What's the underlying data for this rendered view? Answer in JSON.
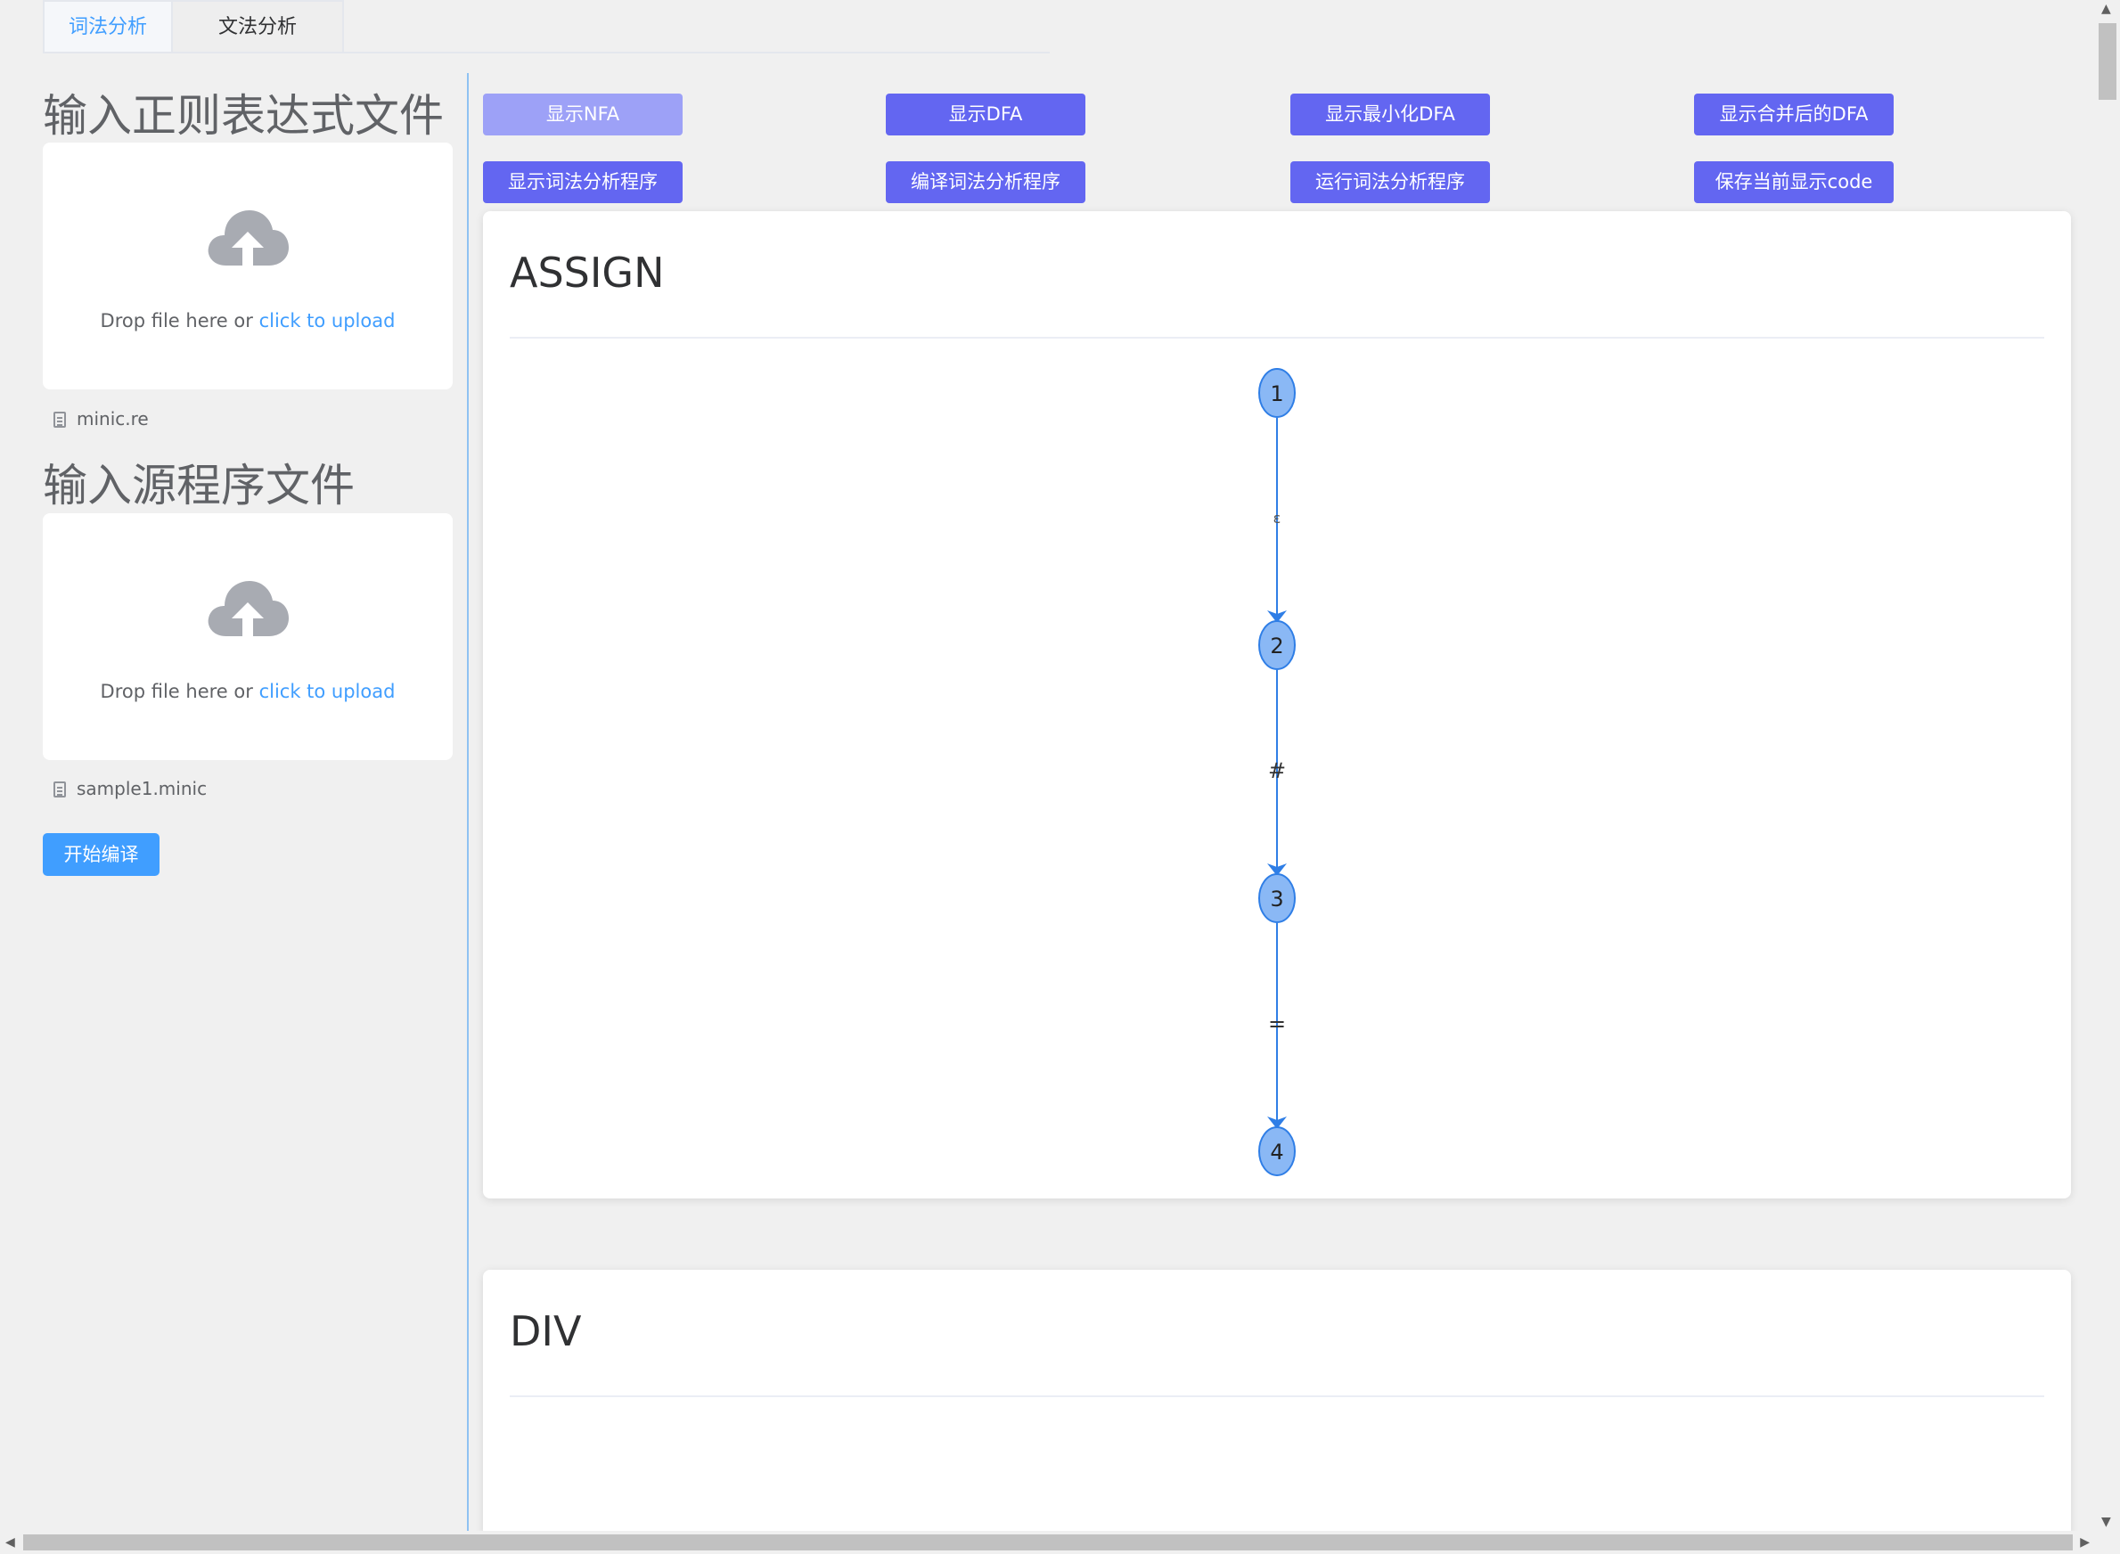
{
  "tabs": [
    {
      "label": "词法分析",
      "active": true
    },
    {
      "label": "文法分析",
      "active": false
    }
  ],
  "sidebar": {
    "regex_section": {
      "title": "输入正则表达式文件",
      "upload_prefix": "Drop file here or ",
      "upload_link": "click to upload",
      "file_name": "minic.re"
    },
    "source_section": {
      "title": "输入源程序文件",
      "upload_prefix": "Drop file here or ",
      "upload_link": "click to upload",
      "file_name": "sample1.minic"
    },
    "compile_label": "开始编译"
  },
  "toolbar": {
    "buttons": [
      {
        "label": "显示NFA",
        "active": true
      },
      {
        "label": "显示DFA"
      },
      {
        "label": "显示最小化DFA"
      },
      {
        "label": "显示合并后的DFA"
      },
      {
        "label": "显示词法分析程序"
      },
      {
        "label": "编译词法分析程序"
      },
      {
        "label": "运行词法分析程序"
      },
      {
        "label": "保存当前显示code"
      }
    ]
  },
  "cards": [
    {
      "title": "ASSIGN",
      "graph": {
        "nodes": [
          "1",
          "2",
          "3",
          "4"
        ],
        "edges": [
          {
            "from": "1",
            "to": "2",
            "label": "ε"
          },
          {
            "from": "2",
            "to": "3",
            "label": "#"
          },
          {
            "from": "3",
            "to": "4",
            "label": "="
          }
        ]
      }
    },
    {
      "title": "DIV"
    }
  ],
  "colors": {
    "accent": "#409eff",
    "button": "#6366f1",
    "button_active": "#9da1f7",
    "node_fill": "#8ab8f5",
    "edge": "#2f7ee6"
  },
  "icons": {
    "upload": "cloud-upload-icon",
    "file": "document-icon"
  }
}
